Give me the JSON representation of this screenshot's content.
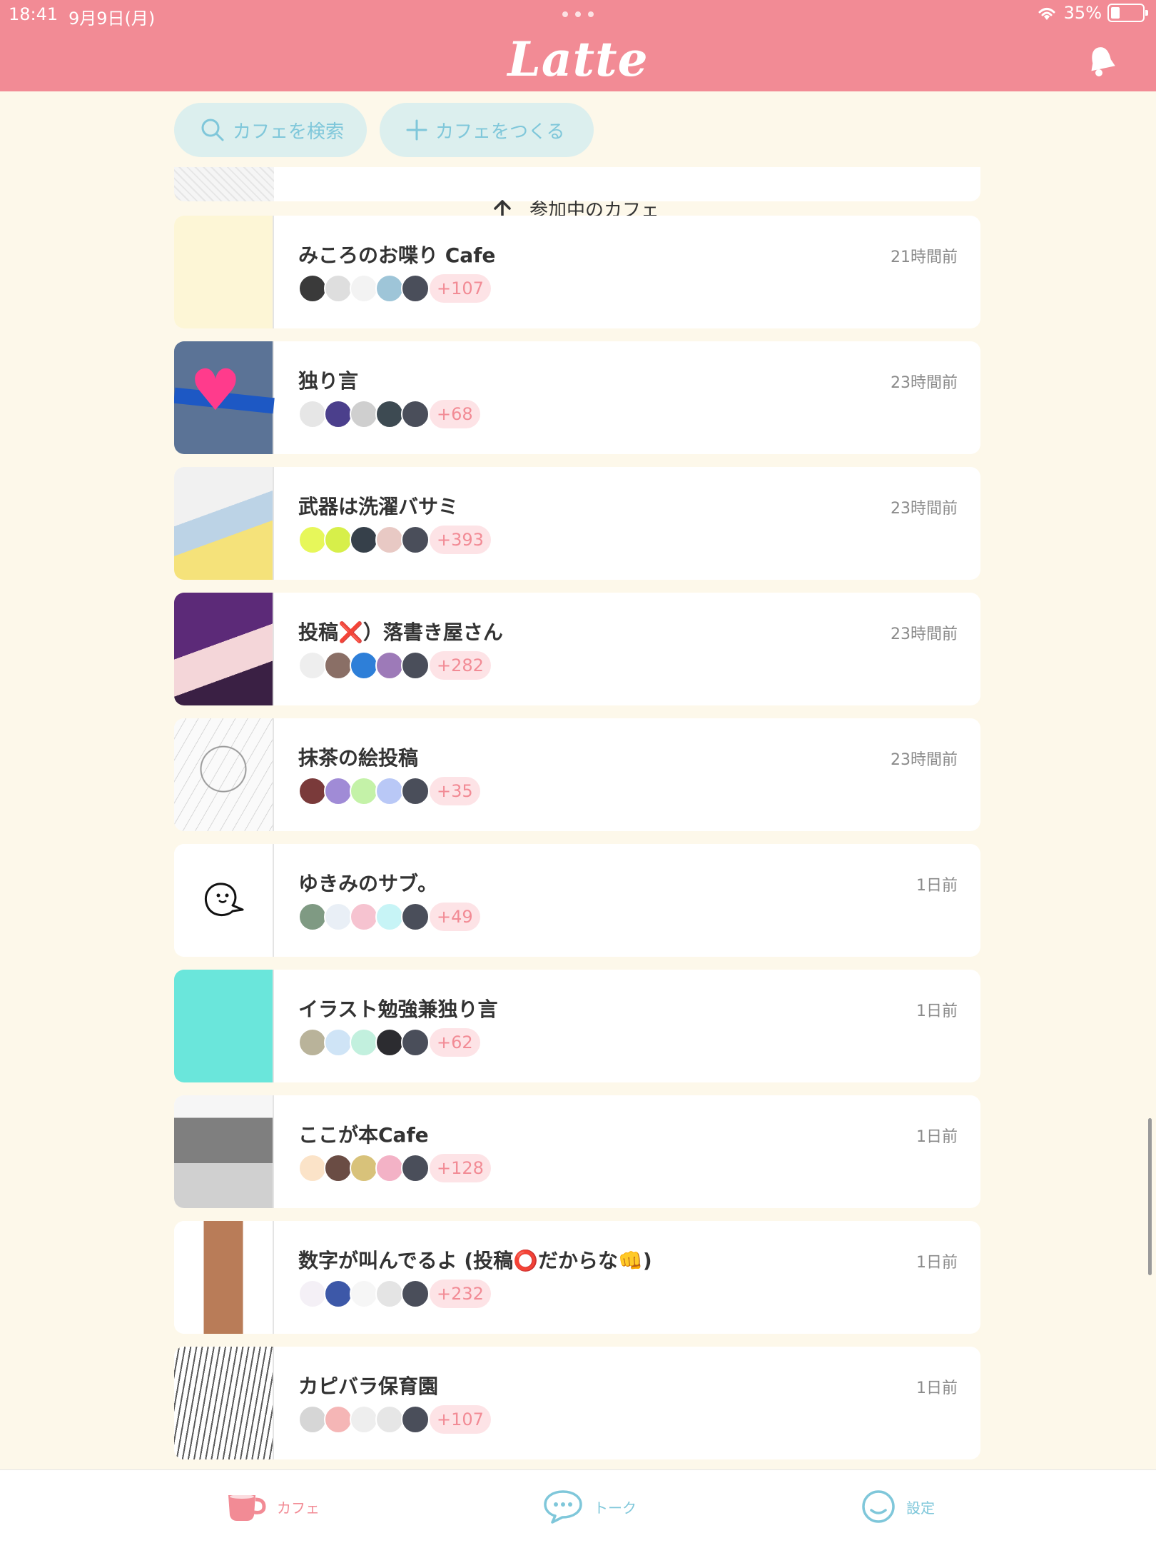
{
  "status_bar": {
    "time": "18:41",
    "date": "9月9日(月)",
    "battery": "35%"
  },
  "app": {
    "title": "Latte"
  },
  "actions": {
    "search_label": "カフェを検索",
    "create_label": "カフェをつくる"
  },
  "section": {
    "label": "参加中のカフェ"
  },
  "cafes": [
    {
      "name": "みころのお喋り Cafe",
      "time": "21時間前",
      "count": "+107",
      "avatars": [
        "#3a3a3a",
        "#dedede",
        "#f3f3f3",
        "#9ec5d8",
        "#4a4e5a"
      ]
    },
    {
      "name": "独り言",
      "time": "23時間前",
      "count": "+68",
      "avatars": [
        "#e6e6e6",
        "#4b3f8c",
        "#cfcfcf",
        "#3d4a52",
        "#4a4e5a"
      ]
    },
    {
      "name": "武器は洗濯バサミ",
      "time": "23時間前",
      "count": "+393",
      "avatars": [
        "#e7f75a",
        "#d7ef4a",
        "#36404a",
        "#e8c9c4",
        "#4a4e5a"
      ]
    },
    {
      "name": "投稿❌）落書き屋さん",
      "time": "23時間前",
      "count": "+282",
      "avatars": [
        "#eeeeee",
        "#8a6f66",
        "#2e7fd8",
        "#9d7ab8",
        "#4a4e5a"
      ]
    },
    {
      "name": "抹茶の絵投稿",
      "time": "23時間前",
      "count": "+35",
      "avatars": [
        "#7a3a3a",
        "#a08bd6",
        "#c4f2a8",
        "#b9c8f6",
        "#4a4e5a"
      ]
    },
    {
      "name": "ゆきみのサブ。",
      "time": "1日前",
      "count": "+49",
      "avatars": [
        "#7f9a83",
        "#e9eff6",
        "#f6c3d0",
        "#c7f4f6",
        "#4a4e5a"
      ]
    },
    {
      "name": "イラスト勉強兼独り言",
      "time": "1日前",
      "count": "+62",
      "avatars": [
        "#b9b39a",
        "#cfe4f6",
        "#c2f0de",
        "#2c2c30",
        "#4a4e5a"
      ]
    },
    {
      "name": "ここが本Cafe",
      "time": "1日前",
      "count": "+128",
      "avatars": [
        "#fbe3c8",
        "#6a4c44",
        "#d8c27a",
        "#f3b2c6",
        "#4a4e5a"
      ]
    },
    {
      "name": "数字が叫んでるよ (投稿⭕️だからな👊)",
      "time": "1日前",
      "count": "+232",
      "avatars": [
        "#f4f0f6",
        "#3d58a8",
        "#f6f6f6",
        "#e4e4e4",
        "#4a4e5a"
      ]
    },
    {
      "name": "カピバラ保育園",
      "time": "1日前",
      "count": "+107",
      "avatars": [
        "#d6d6d6",
        "#f5b6b6",
        "#eeeeee",
        "#e6e6e6",
        "#4a4e5a"
      ]
    }
  ],
  "tabs": {
    "cafe": "カフェ",
    "talk": "トーク",
    "settings": "設定"
  },
  "colors": {
    "header": "#f28b95",
    "background": "#fdf8ea",
    "accent_blue": "#7fc7da",
    "badge_bg": "#fde3e6"
  }
}
